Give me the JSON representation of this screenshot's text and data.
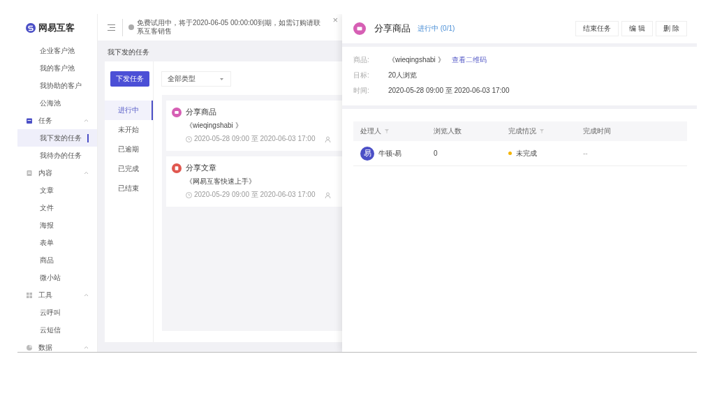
{
  "sidebar": {
    "logo": "网易互客",
    "sections": [
      {
        "items": [
          {
            "label": "企业客户池",
            "selected": false
          },
          {
            "label": "我的客户池",
            "selected": false
          },
          {
            "label": "我协助的客户",
            "selected": false
          },
          {
            "label": "公海池",
            "selected": false
          }
        ]
      },
      {
        "title": "任务",
        "kind": "task",
        "expanded": true,
        "items": [
          {
            "label": "我下发的任务",
            "selected": true
          },
          {
            "label": "我待办的任务",
            "selected": false
          }
        ]
      },
      {
        "title": "内容",
        "kind": "doc",
        "expanded": true,
        "items": [
          {
            "label": "文章",
            "selected": false
          },
          {
            "label": "文件",
            "selected": false
          },
          {
            "label": "海报",
            "selected": false
          },
          {
            "label": "表单",
            "selected": false
          },
          {
            "label": "商品",
            "selected": false
          },
          {
            "label": "微小站",
            "selected": false
          }
        ]
      },
      {
        "title": "工具",
        "kind": "grid",
        "expanded": true,
        "items": [
          {
            "label": "云呼叫",
            "selected": false
          },
          {
            "label": "云短信",
            "selected": false
          }
        ]
      },
      {
        "title": "数据",
        "kind": "chart",
        "expanded": true
      }
    ]
  },
  "notice": {
    "text": "免费试用中，将于2020-06-05 00:00:00到期，如需订购请联系互客销售",
    "close": "×"
  },
  "page_title": "我下发的任务",
  "issue_button": "下发任务",
  "type_filter": {
    "value": "全部类型"
  },
  "status_tabs": [
    {
      "label": "进行中",
      "selected": true
    },
    {
      "label": "未开始",
      "selected": false
    },
    {
      "label": "已逾期",
      "selected": false
    },
    {
      "label": "已完成",
      "selected": false
    },
    {
      "label": "已结束",
      "selected": false
    }
  ],
  "tasks": [
    {
      "kind": "goods",
      "color": "#d65fb4",
      "title": "分享商品",
      "subject": "《wieqingshabi 》",
      "time": "2020-05-28 09:00 至 2020-06-03 17:00"
    },
    {
      "kind": "article",
      "color": "#e0574f",
      "title": "分享文章",
      "subject": "《网易互客快速上手》",
      "time": "2020-05-29 09:00 至 2020-06-03 17:00"
    }
  ],
  "detail": {
    "kind": "goods",
    "color": "#d65fb4",
    "title": "分享商品",
    "status": "进行中 (0/1)",
    "buttons": [
      "结束任务",
      "编 辑",
      "删 除"
    ],
    "fields": [
      {
        "label": "商品:",
        "value": "《wieqingshabi 》",
        "link": "查看二维码"
      },
      {
        "label": "目标:",
        "value": "20人浏览"
      },
      {
        "label": "时间:",
        "value": "2020-05-28 09:00 至 2020-06-03 17:00"
      }
    ],
    "table": {
      "columns": [
        {
          "label": "处理人",
          "filter": true
        },
        {
          "label": "浏览人数",
          "filter": false
        },
        {
          "label": "完成情况",
          "filter": true
        },
        {
          "label": "完成时间",
          "filter": false
        }
      ],
      "rows": [
        {
          "avatar": "易",
          "name": "牛顿-易",
          "views": "0",
          "status": "未完成",
          "color": "#f5b400",
          "finished": "--"
        }
      ]
    }
  }
}
